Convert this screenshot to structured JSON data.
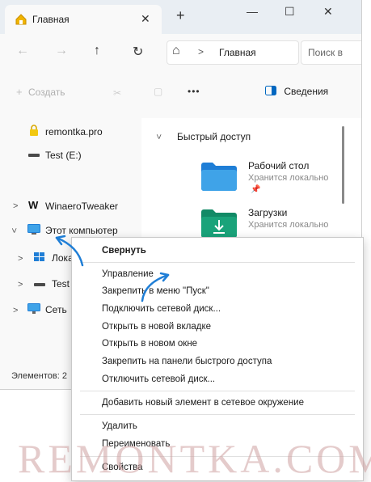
{
  "window": {
    "tab_title": "Главная",
    "tab_close": "✕",
    "new_tab": "+",
    "minimize": "—",
    "maximize": "☐",
    "close": "✕"
  },
  "nav": {
    "back": "←",
    "forward": "→",
    "up": "↑",
    "refresh": "↻",
    "home": "⌂",
    "crumb_sep": ">",
    "location": "Главная",
    "search_placeholder": "Поиск в"
  },
  "toolbar": {
    "create_label": "Создать",
    "more": "•••",
    "details_label": "Сведения"
  },
  "sidebar": {
    "items": [
      {
        "label": "remontka.pro",
        "icon": "lock-icon"
      },
      {
        "label": "Test (E:)",
        "icon": "drive-icon"
      },
      {
        "label": "WinaeroTweaker",
        "icon": "winaero-icon"
      },
      {
        "label": "Этот компьютер",
        "icon": "computer-icon"
      },
      {
        "label": "Лока",
        "icon": "drive-icon"
      },
      {
        "label": "Test",
        "icon": "drive-icon"
      },
      {
        "label": "Сеть",
        "icon": "network-icon"
      }
    ]
  },
  "quick_access": {
    "header": "Быстрый доступ",
    "items": [
      {
        "name": "Рабочий стол",
        "status": "Хранится локально",
        "icon": "desktop-folder-icon"
      },
      {
        "name": "Загрузки",
        "status": "Хранится локально",
        "icon": "downloads-folder-icon"
      }
    ]
  },
  "status": {
    "items_text": "Элементов: 2"
  },
  "context_menu": {
    "items": [
      "Свернуть",
      "Управление",
      "Закрепить в меню \"Пуск\"",
      "Подключить сетевой диск...",
      "Открыть в новой вкладке",
      "Открыть в новом окне",
      "Закрепить на панели быстрого доступа",
      "Отключить сетевой диск...",
      "Добавить новый элемент в сетевое окружение",
      "Удалить",
      "Переименовать",
      "Свойства"
    ]
  },
  "watermark": "REMONTKA.COM",
  "colors": {
    "accent": "#0067c0",
    "folder_blue": "#2b8fd6",
    "folder_green": "#1aa37a",
    "lock_yellow": "#f2c811",
    "arrow": "#1f7ed6"
  }
}
